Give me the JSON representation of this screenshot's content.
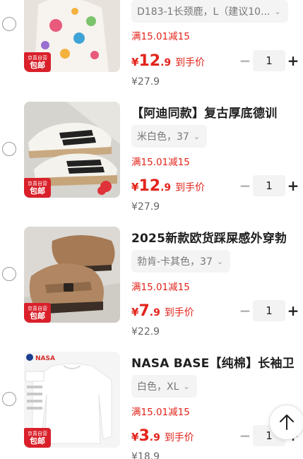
{
  "colors": {
    "accent": "#e2231a",
    "badge": "#d9202a"
  },
  "badge": {
    "line1": "京喜自营",
    "line2": "包邮"
  },
  "items": [
    {
      "title": "",
      "spec": "D183-1长颈鹿，L（建议10...",
      "promo": "满15.01减15",
      "currency": "¥",
      "price_int": "12",
      "price_dec": ".9",
      "price_tag": "到手价",
      "orig_price": "¥27.9",
      "qty": "1"
    },
    {
      "title": "【阿迪同款】复古厚底德训",
      "spec": "米白色，37",
      "promo": "满15.01减15",
      "currency": "¥",
      "price_int": "12",
      "price_dec": ".9",
      "price_tag": "到手价",
      "orig_price": "¥27.9",
      "qty": "1"
    },
    {
      "title": "2025新款欧货踩屎感外穿勃",
      "spec": "勃肯-卡其色，37",
      "promo": "满15.01减15",
      "currency": "¥",
      "price_int": "7",
      "price_dec": ".9",
      "price_tag": "到手价",
      "orig_price": "¥22.9",
      "qty": "1"
    },
    {
      "title": "NASA BASE【纯棉】长袖卫",
      "spec": "白色，XL",
      "promo": "满15.01减15",
      "currency": "¥",
      "price_int": "3",
      "price_dec": ".9",
      "price_tag": "到手价",
      "orig_price": "¥18.9",
      "qty": "1"
    }
  ],
  "tshirt_logo": "NASA",
  "scroll_top_icon": "arrow-up-icon"
}
